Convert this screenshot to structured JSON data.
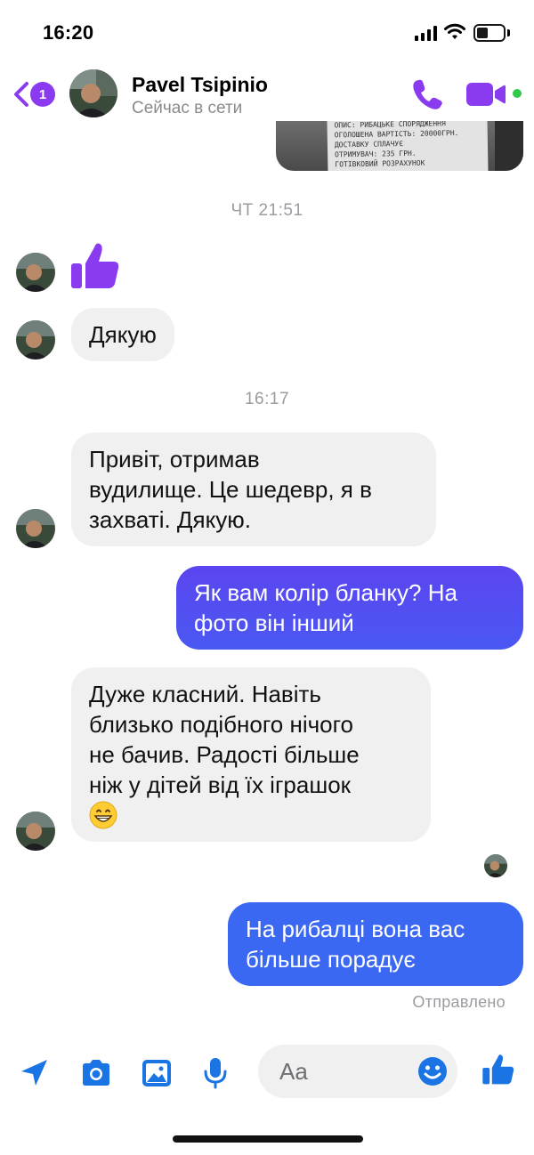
{
  "status_bar": {
    "time": "16:20"
  },
  "header": {
    "back_badge": "1",
    "contact_name": "Pavel Tsipinio",
    "contact_status": "Сейчас в сети"
  },
  "photo_peek": {
    "lines": [
      "ОПИС: РИБАЦЬКЕ СПОРЯДЖЕННЯ",
      "ОГОЛОШЕНА ВАРТІСТЬ: 20000ГРН.",
      "ДОСТАВКУ СПЛАЧУЄ",
      "ОТРИМУВАЧ: 235 ГРН.",
      "ГОТІВКОВИЙ РОЗРАХУНОК"
    ]
  },
  "messages": {
    "timestamp_1": "ЧТ 21:51",
    "incoming_1": "Дякую",
    "timestamp_2": "16:17",
    "incoming_2_lines": [
      "Привіт, отримав",
      "вудилище. Це шедевр, я в",
      "захваті. Дякую."
    ],
    "outgoing_1_lines": [
      "Як вам колір бланку? На",
      "фото він інший"
    ],
    "incoming_3_lines": [
      "Дуже класний. Навіть",
      "близько подібного нічого",
      "не бачив. Радості більше",
      "ніж у дітей від їх іграшок"
    ],
    "outgoing_2_lines": [
      "На рибалці вона вас",
      "більше порадує"
    ],
    "sent_status": "Отправлено"
  },
  "composer": {
    "placeholder": "Aa"
  },
  "colors": {
    "accent_purple": "#8a3bf0",
    "accent_blue": "#1b74e4",
    "bubble_out_top": "#6a3cf0",
    "bubble_out_bottom": "#3f6af2",
    "online": "#31c94a"
  },
  "icons": {
    "back": "chevron-left-icon",
    "call": "phone-icon",
    "video": "video-camera-icon",
    "reaction": "thumbs-up-icon",
    "location": "location-arrow-icon",
    "camera": "camera-icon",
    "gallery": "image-icon",
    "mic": "microphone-icon",
    "emoji": "smiley-icon",
    "like": "thumbs-up-icon"
  }
}
